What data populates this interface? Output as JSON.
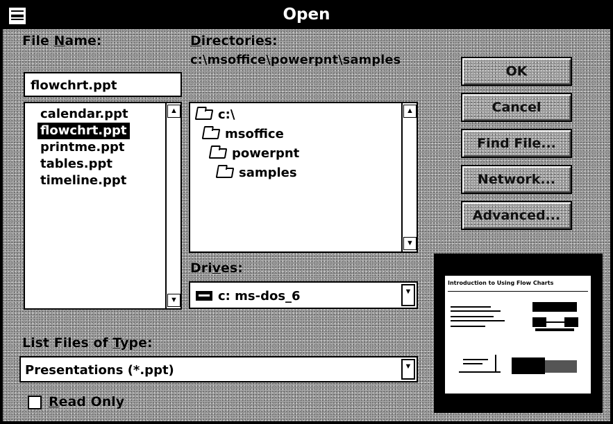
{
  "window": {
    "title": "Open"
  },
  "file_name": {
    "label_prefix": "File ",
    "label_accel": "N",
    "label_rest": "ame:",
    "value": "flowchrt.ppt"
  },
  "files": [
    "calendar.ppt",
    "flowchrt.ppt",
    "printme.ppt",
    "tables.ppt",
    "timeline.ppt"
  ],
  "selected_file": "flowchrt.ppt",
  "directories": {
    "label_accel": "D",
    "label_rest": "irectories:",
    "current_path": "c:\\msoffice\\powerpnt\\samples",
    "items": [
      "c:\\",
      "msoffice",
      "powerpnt",
      "samples"
    ]
  },
  "drives": {
    "label_prefix": "Dri",
    "label_accel": "v",
    "label_rest": "es:",
    "value": "c: ms-dos_6"
  },
  "file_type": {
    "label_prefix": "List Files of ",
    "label_accel": "T",
    "label_rest": "ype:",
    "value": "Presentations (*.ppt)"
  },
  "read_only": {
    "label_accel": "R",
    "label_rest": "ead Only",
    "checked": false
  },
  "buttons": {
    "ok": "OK",
    "cancel": "Cancel",
    "find_file": "Find File...",
    "network": "Network...",
    "advanced": "Advanced..."
  },
  "preview": {
    "slide_title": "Introduction to Using Flow Charts"
  },
  "colors": {
    "selection": "#000000",
    "dialog_bg": "#a7a7a7"
  }
}
